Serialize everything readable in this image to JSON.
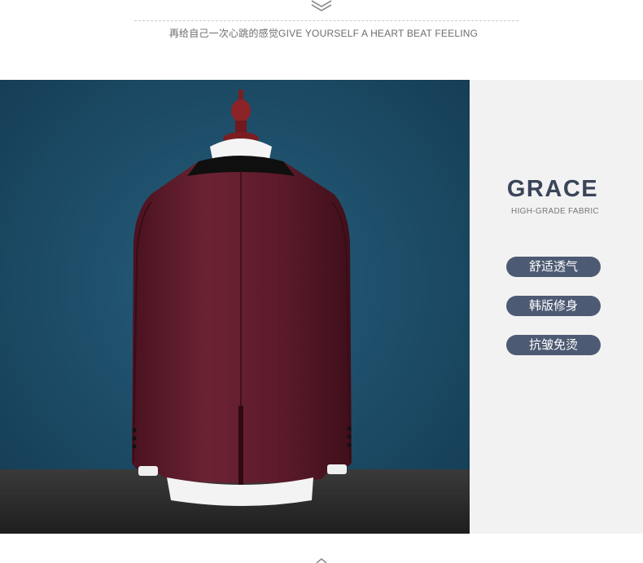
{
  "header": {
    "tagline": "再给自己一次心跳的感觉GIVE YOURSELF A HEART BEAT FEELING",
    "icon": "layers-chevron-icon"
  },
  "photo": {
    "subject": "burgundy-suit-jacket-back-view",
    "colors": {
      "background": "#1f4f6b",
      "jacket": "#5c1a28",
      "lapel": "#111111",
      "floor": "#2a2a2a"
    }
  },
  "panel": {
    "title": "GRACE",
    "subtitle": "HIGH-GRADE FABRIC",
    "features": [
      "舒适透气",
      "韩版修身",
      "抗皱免烫"
    ],
    "colors": {
      "background": "#f2f2f2",
      "title": "#3a4559",
      "pill": "#4d5a73"
    }
  }
}
